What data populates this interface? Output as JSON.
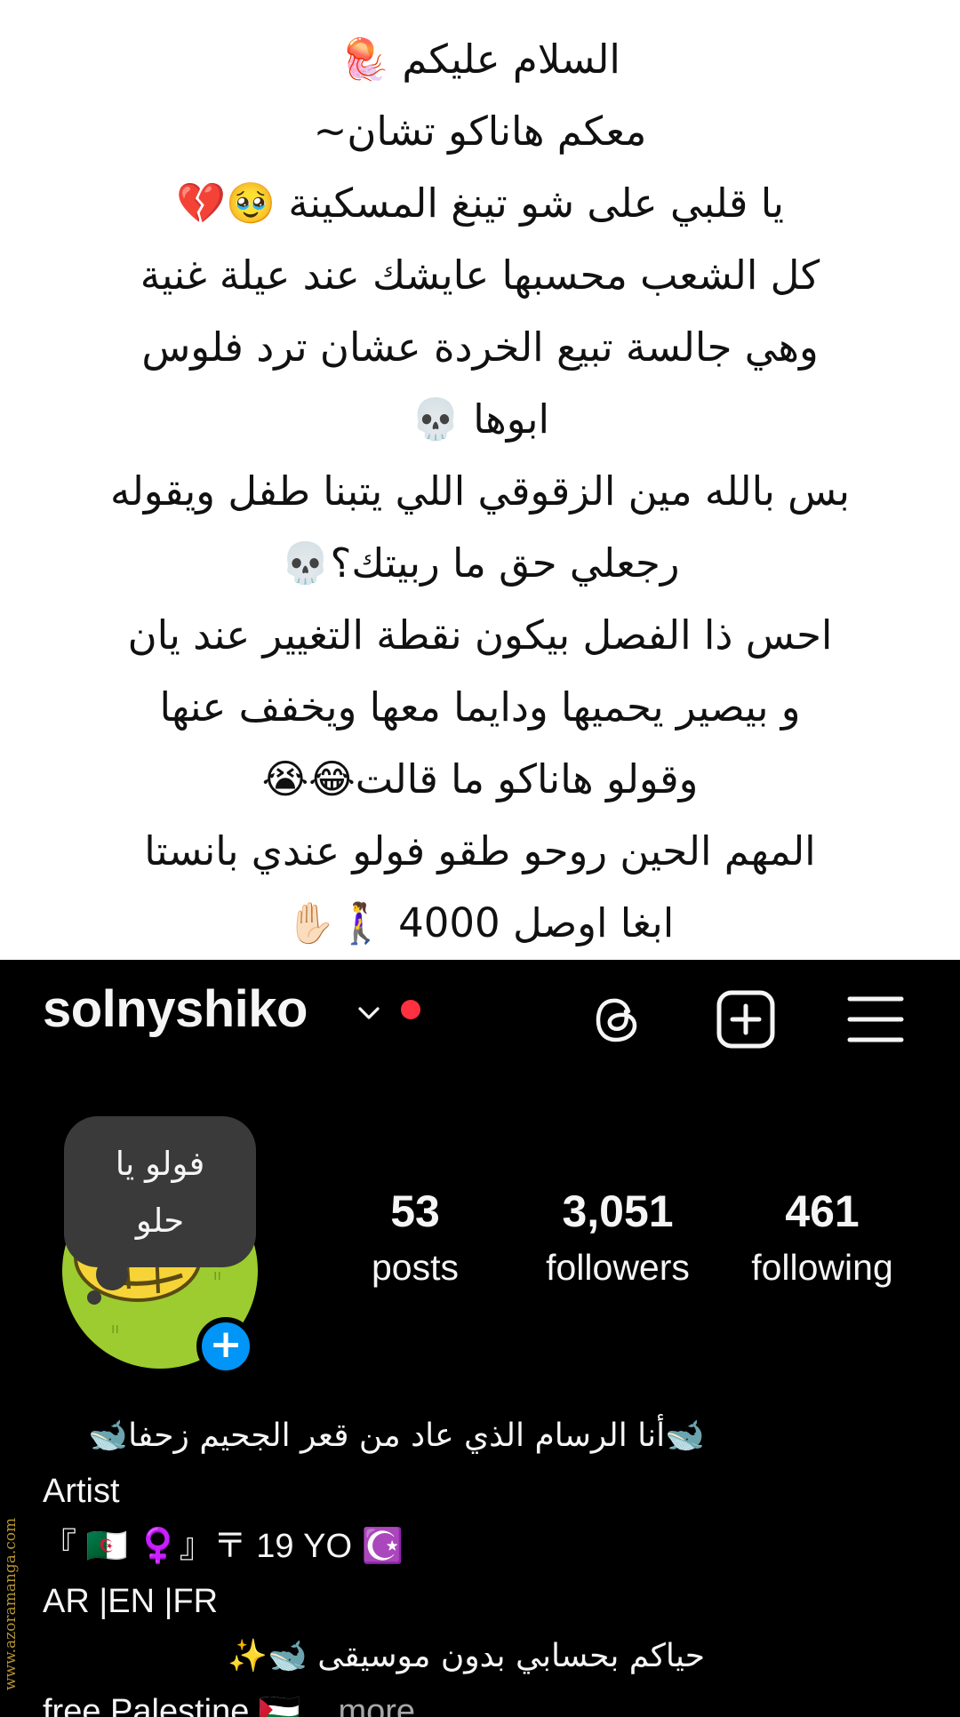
{
  "note": {
    "lines": [
      "السلام عليكم 🪼",
      "معكم هاناكو تشان~",
      "يا قلبي على شو تينغ المسكينة 🥹💔",
      "كل الشعب محسبها عايشك عند عيلة غنية",
      "وهي جالسة تبيع الخردة عشان ترد فلوس",
      "ابوها 💀",
      "بس بالله مين الزقوقي اللي يتبنا طفل ويقوله",
      "رجعلي حق ما ربيتك؟💀",
      "احس ذا الفصل بيكون نقطة التغيير عند يان",
      "و بيصير يحميها ودايما معها ويخفف عنها",
      "وقولو هاناكو ما قالت😂😭",
      "المهم الحين روحو طقو فولو عندي بانستا",
      "ابغا اوصل 4000 🚶‍♀️✋🏻"
    ]
  },
  "profile": {
    "username": "solnyshiko",
    "icons": {
      "dropdown": "chevron-down-icon",
      "notification": "red-dot-icon",
      "threads": "threads-icon",
      "create": "plus-square-icon",
      "menu": "hamburger-menu-icon"
    },
    "colors": {
      "background": "#000000",
      "text": "#f5f5f5",
      "notification_dot": "#ff3040",
      "add_story": "#0095f6",
      "note_bubble": "#3a3a3a",
      "avatar": "#9ccc2f"
    },
    "note_bubble": {
      "line1": "فولو يا",
      "line2": "حلو"
    },
    "add_story_symbol": "+",
    "stats": {
      "posts": {
        "value": "53",
        "label": "posts"
      },
      "followers": {
        "value": "3,051",
        "label": "followers"
      },
      "following": {
        "value": "461",
        "label": "following"
      }
    },
    "bio": {
      "line1": "🐋أنا الرسام الذي عاد من قعر الجحيم زحفا🐋",
      "line2": "Artist",
      "line3": "『 🇩🇿 ♀️』〒 19 YO ☪️",
      "line4": "AR |EN |FR",
      "line5": "حياكم بحسابي بدون موسيقى 🐋✨",
      "line6": "free Palestine 🇵🇸...",
      "more": " more"
    }
  },
  "watermark": "www.azoramanga.com"
}
